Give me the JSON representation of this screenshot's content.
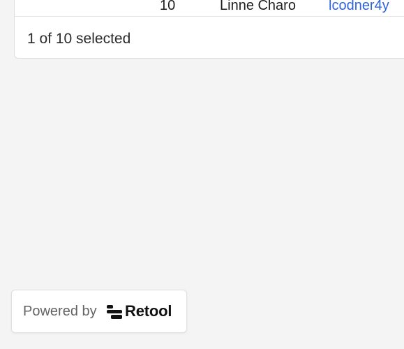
{
  "table": {
    "visible_row": {
      "id": "10",
      "name": "Linne Charo",
      "email": "lcodner4y"
    },
    "selection_status": "1 of 10 selected"
  },
  "badge": {
    "powered_by": "Powered by",
    "brand": "Retool",
    "logo_icon": "retool-logo-icon"
  }
}
